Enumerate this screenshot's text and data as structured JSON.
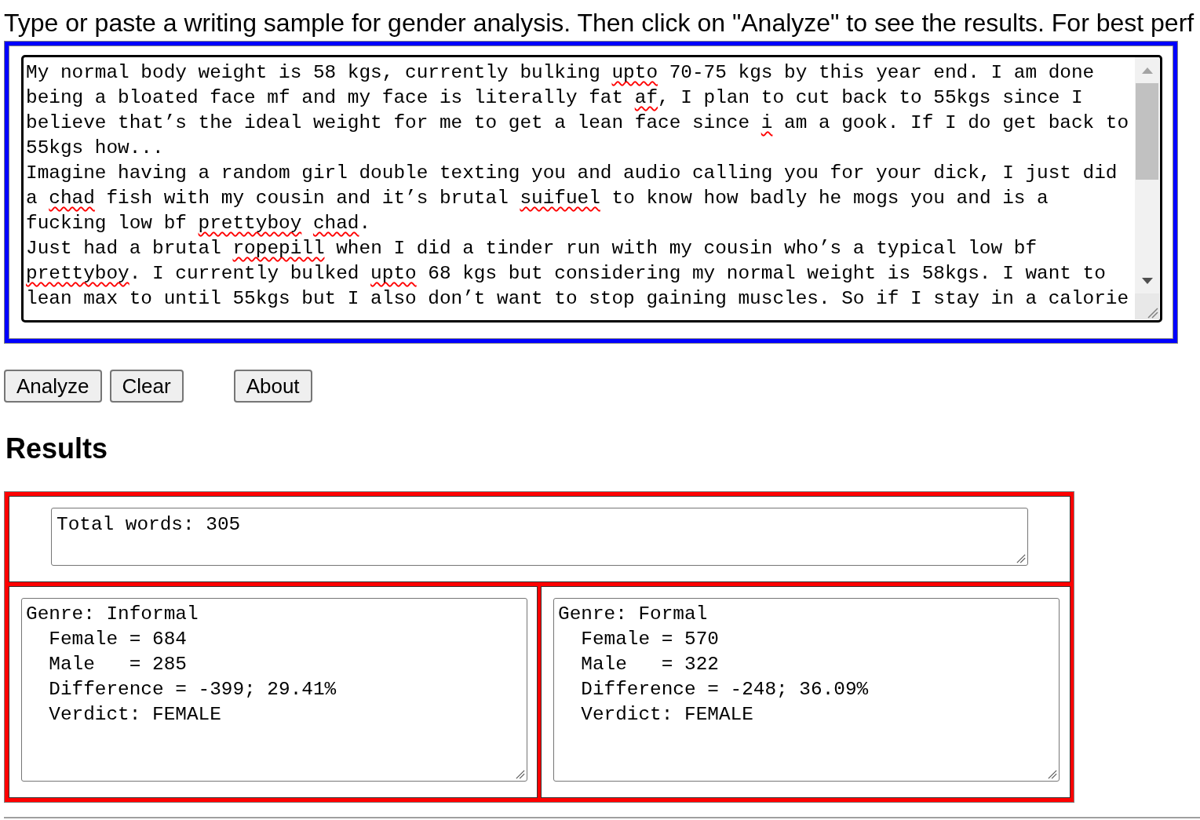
{
  "instructions": "Type or paste a writing sample for gender analysis. Then click on \"Analyze\" to see the results. For best perf",
  "sample_input": {
    "paragraphs": [
      [
        {
          "text": "My normal body weight is 58 kgs, currently bulking ",
          "kind": "plain"
        },
        {
          "text": "upto",
          "kind": "misspelled"
        },
        {
          "text": " 70-75 kgs by this year end. I am done being a bloated face mf and my face is literally fat ",
          "kind": "plain"
        },
        {
          "text": "af",
          "kind": "misspelled"
        },
        {
          "text": ", I plan to cut back to 55kgs since I believe that’s the ideal weight for me to get a lean face since ",
          "kind": "plain"
        },
        {
          "text": "i",
          "kind": "misspelled"
        },
        {
          "text": " am a gook. If I do get back to 55kgs how...",
          "kind": "plain"
        }
      ],
      [
        {
          "text": "Imagine having a random girl double texting you and audio calling you for your dick, I just did a ",
          "kind": "plain"
        },
        {
          "text": "chad",
          "kind": "misspelled"
        },
        {
          "text": " fish with my cousin and it’s brutal ",
          "kind": "plain"
        },
        {
          "text": "suifuel",
          "kind": "misspelled"
        },
        {
          "text": " to know how badly he mogs you and is a fucking low bf ",
          "kind": "plain"
        },
        {
          "text": "prettyboy ",
          "kind": "misspelled"
        },
        {
          "text": "chad",
          "kind": "misspelled"
        },
        {
          "text": ".",
          "kind": "plain"
        }
      ],
      [
        {
          "text": "Just had a brutal ",
          "kind": "plain"
        },
        {
          "text": "ropepill",
          "kind": "misspelled"
        },
        {
          "text": " when I did a tinder run with my cousin who’s a typical low bf ",
          "kind": "plain"
        },
        {
          "text": "prettyboy",
          "kind": "misspelled"
        },
        {
          "text": ". I currently bulked ",
          "kind": "plain"
        },
        {
          "text": "upto",
          "kind": "misspelled"
        },
        {
          "text": " 68 kgs but considering my normal weight is 58kgs. I want to lean max to until 55kgs but I also don’t want to stop gaining muscles. So if I stay in a calorie",
          "kind": "plain"
        }
      ]
    ]
  },
  "buttons": [
    "Analyze",
    "Clear"
  ],
  "about_button": "About",
  "results": {
    "heading": "Results",
    "total_words": "Total words: 305",
    "genres": [
      {
        "title": "Genre: Informal",
        "lines": [
          "Female = 684",
          "Male   = 285",
          "Difference = -399; 29.41%",
          "Verdict: FEMALE"
        ]
      },
      {
        "title": "Genre: Formal",
        "lines": [
          "Female = 570",
          "Male   = 322",
          "Difference = -248; 36.09%",
          "Verdict: FEMALE"
        ]
      }
    ]
  }
}
